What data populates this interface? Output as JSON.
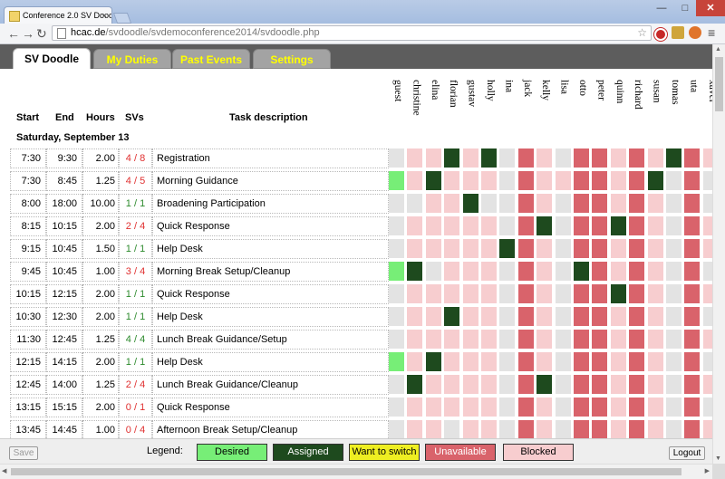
{
  "browser": {
    "tab_title": "Conference 2.0 SV Doodle",
    "tab_close": "×",
    "url_host": "hcac.de",
    "url_path": "/svdoodle/svdemoconference2014/svdoodle.php",
    "star": "☆",
    "back": "←",
    "forward": "→",
    "reload": "↻",
    "menu": "≡",
    "win_min": "—",
    "win_max": "□",
    "win_close": "✕"
  },
  "tabs": {
    "sv_doodle": "SV Doodle",
    "my_duties": "My Duties",
    "past_events": "Past Events",
    "settings": "Settings"
  },
  "columns": {
    "start": "Start",
    "end": "End",
    "hours": "Hours",
    "svs": "SVs",
    "task": "Task description"
  },
  "day_header": "Saturday, September 13",
  "people": [
    "guest",
    "christine",
    "elina",
    "florian",
    "gustav",
    "holly",
    "ina",
    "jack",
    "kelly",
    "lisa",
    "otto",
    "peter",
    "quinn",
    "richard",
    "susan",
    "tomas",
    "uta",
    "xaver"
  ],
  "status_colors": {
    "D": "#77ee77",
    "A": "#1e4a1e",
    "W": "#eeee22",
    "U": "#d9636b",
    "B": "#f7cdcf",
    "N": "#e3e3e3"
  },
  "rows": [
    {
      "start": "7:30",
      "end": "9:30",
      "hours": "2.00",
      "svs": "4 / 8",
      "svs_ok": false,
      "task": "Registration",
      "cells": "NBBABANUBNUUBUBAUB"
    },
    {
      "start": "7:30",
      "end": "8:45",
      "hours": "1.25",
      "svs": "4 / 5",
      "svs_ok": false,
      "task": "Morning Guidance",
      "cells": "DBABBBNUBBUUBUANUN"
    },
    {
      "start": "8:00",
      "end": "18:00",
      "hours": "10.00",
      "svs": "1 / 1",
      "svs_ok": true,
      "task": "Broadening Participation",
      "cells": "NNBBANNUBNUUBUBNUN"
    },
    {
      "start": "8:15",
      "end": "10:15",
      "hours": "2.00",
      "svs": "2 / 4",
      "svs_ok": false,
      "task": "Quick Response",
      "cells": "NBBBBBNUANUUAUBNUB"
    },
    {
      "start": "9:15",
      "end": "10:45",
      "hours": "1.50",
      "svs": "1 / 1",
      "svs_ok": true,
      "task": "Help Desk",
      "cells": "NBBBBBAUBNUUBUBNUB"
    },
    {
      "start": "9:45",
      "end": "10:45",
      "hours": "1.00",
      "svs": "3 / 4",
      "svs_ok": false,
      "task": "Morning Break Setup/Cleanup",
      "cells": "DANBBBNUBNAUBUBNUN"
    },
    {
      "start": "10:15",
      "end": "12:15",
      "hours": "2.00",
      "svs": "1 / 1",
      "svs_ok": true,
      "task": "Quick Response",
      "cells": "NBBBBBNUBNUUAUBNUB"
    },
    {
      "start": "10:30",
      "end": "12:30",
      "hours": "2.00",
      "svs": "1 / 1",
      "svs_ok": true,
      "task": "Help Desk",
      "cells": "NBBABBNUBNUUBUBNUN"
    },
    {
      "start": "11:30",
      "end": "12:45",
      "hours": "1.25",
      "svs": "4 / 4",
      "svs_ok": true,
      "task": "Lunch Break Guidance/Setup",
      "cells": "NBBBBBNUBNUUBUBNUB"
    },
    {
      "start": "12:15",
      "end": "14:15",
      "hours": "2.00",
      "svs": "1 / 1",
      "svs_ok": true,
      "task": "Help Desk",
      "cells": "DBABBBNUBNUUBUBNUN"
    },
    {
      "start": "12:45",
      "end": "14:00",
      "hours": "1.25",
      "svs": "2 / 4",
      "svs_ok": false,
      "task": "Lunch Break Guidance/Cleanup",
      "cells": "NABBBBNUANUUBUBNUB"
    },
    {
      "start": "13:15",
      "end": "15:15",
      "hours": "2.00",
      "svs": "0 / 1",
      "svs_ok": false,
      "task": "Quick Response",
      "cells": "NBBBBBNUBNUUBUBNUN"
    },
    {
      "start": "13:45",
      "end": "14:45",
      "hours": "1.00",
      "svs": "0 / 4",
      "svs_ok": false,
      "task": "Afternoon Break Setup/Cleanup",
      "cells": "NBBNBBNUBNUUBUBNUB"
    }
  ],
  "footer": {
    "save": "Save",
    "legend_label": "Legend:",
    "logout": "Logout",
    "legend": [
      {
        "label": "Desired",
        "bg": "#77ee77",
        "fg": "#000000"
      },
      {
        "label": "Assigned",
        "bg": "#1e4a1e",
        "fg": "#ffffff"
      },
      {
        "label": "Want to switch",
        "bg": "#eeee22",
        "fg": "#000000"
      },
      {
        "label": "Unavailable",
        "bg": "#d9636b",
        "fg": "#ffffff"
      },
      {
        "label": "Blocked",
        "bg": "#f7cdcf",
        "fg": "#000000"
      }
    ]
  }
}
